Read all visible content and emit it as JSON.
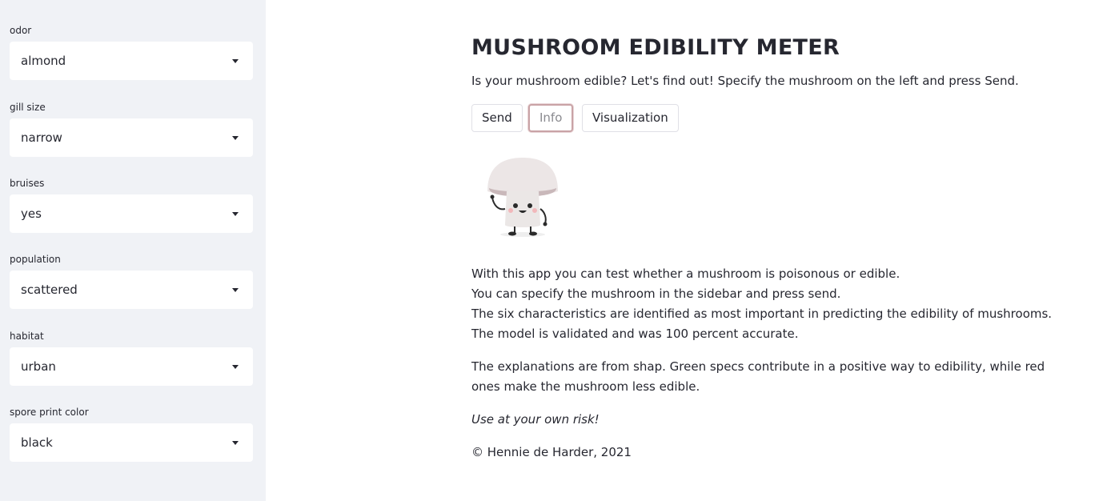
{
  "sidebar": {
    "fields": [
      {
        "label": "odor",
        "value": "almond"
      },
      {
        "label": "gill size",
        "value": "narrow"
      },
      {
        "label": "bruises",
        "value": "yes"
      },
      {
        "label": "population",
        "value": "scattered"
      },
      {
        "label": "habitat",
        "value": "urban"
      },
      {
        "label": "spore print color",
        "value": "black"
      }
    ]
  },
  "main": {
    "title": "MUSHROOM EDIBILITY METER",
    "subtitle": "Is your mushroom edible? Let's find out! Specify the mushroom on the left and press Send.",
    "buttons": {
      "send": "Send",
      "info": "Info",
      "visualization": "Visualization"
    },
    "info_lines": [
      "With this app you can test whether a mushroom is poisonous or edible.",
      "You can specify the mushroom in the sidebar and press send.",
      "The six characteristics are identified as most important in predicting the edibility of mushrooms.",
      "The model is validated and was 100 percent accurate."
    ],
    "explanation_lines": [
      "The explanations are from shap. Green specs contribute in a positive way to edibility, while red",
      "ones make the mushroom less edible."
    ],
    "warning": "Use at your own risk!",
    "copyright": "© Hennie de Harder, 2021"
  },
  "colors": {
    "sidebar_bg": "#f0f2f6",
    "text": "#262730",
    "focus_ring": "#c9a3a6"
  },
  "icons": {
    "select_caret": "chevron-down-icon",
    "mascot": "mushroom-mascot"
  }
}
